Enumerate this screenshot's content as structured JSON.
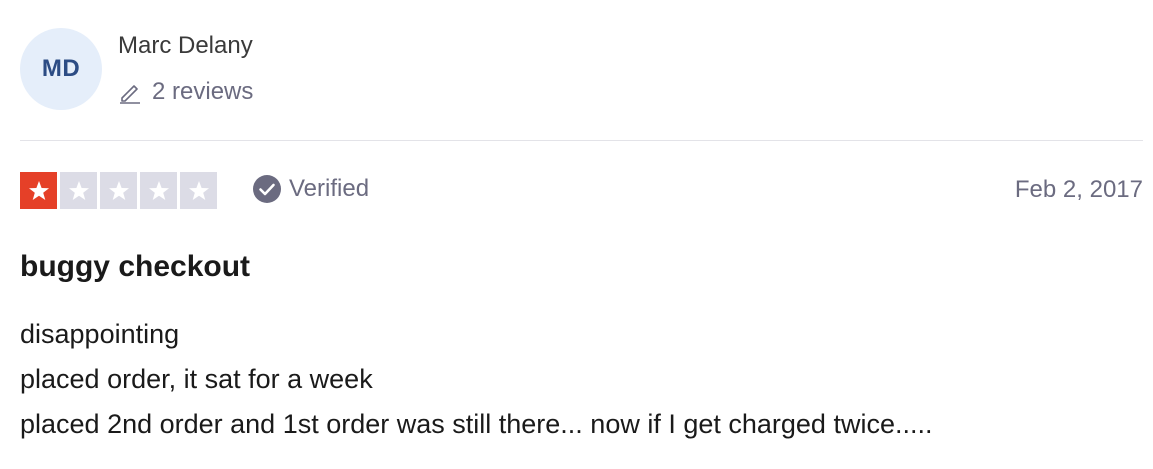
{
  "reviewer": {
    "initials": "MD",
    "name": "Marc Delany",
    "reviews_count": "2 reviews",
    "edit_icon": "pencil-icon"
  },
  "rating": {
    "value": 1,
    "max": 5,
    "filled_color": "#e54028",
    "empty_color": "#dcdce6"
  },
  "verified": {
    "label": "Verified",
    "icon": "check-circle-icon"
  },
  "date": "Feb 2, 2017",
  "review": {
    "title": "buggy checkout",
    "lines": [
      "disappointing",
      "placed order, it sat for a week",
      "placed 2nd order and 1st order was still there... now if I get charged twice....."
    ]
  }
}
